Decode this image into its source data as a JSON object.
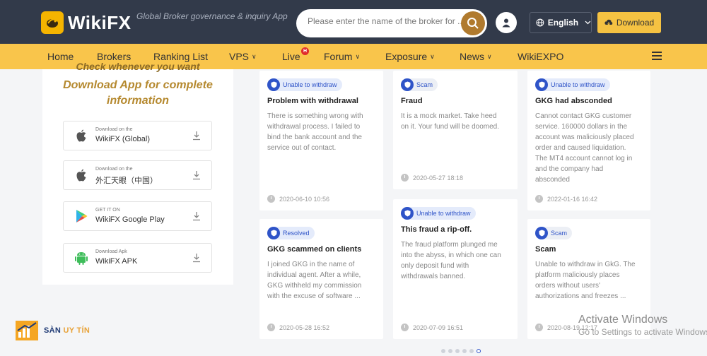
{
  "header": {
    "logo_text": "WikiFX",
    "tagline": "Global Broker governance & inquiry App",
    "search_placeholder": "Please enter the name of the broker for ...",
    "language": "English",
    "download": "Download"
  },
  "nav": {
    "items": [
      "Home",
      "Brokers",
      "Ranking List",
      "VPS",
      "Live",
      "Forum",
      "Exposure",
      "News",
      "WikiEXPO"
    ],
    "live_badge": "H"
  },
  "sidebar": {
    "cut_text": "Check whenever you want",
    "title": "Download App for complete information",
    "stores": [
      {
        "small": "Download on the",
        "name": "WikiFX (Global)"
      },
      {
        "small": "Download on the",
        "name": "外汇天眼（中国）"
      },
      {
        "small": "GET IT ON",
        "name": "WikiFX Google Play"
      },
      {
        "small": "Download Apk",
        "name": "WikiFX APK"
      }
    ]
  },
  "cards": [
    {
      "tag": "Unable to withdraw",
      "title": "Problem with withdrawal",
      "body": "There is something wrong with withdrawal process. I failed to bind the bank account and the service out of contact.",
      "date": "2020-06-10 10:56"
    },
    {
      "tag": "Resolved",
      "title": "GKG scammed on clients",
      "body": "I joined GKG in the name of individual agent. After a while, GKG withheld my commission with the excuse of software ...",
      "date": "2020-05-28 16:52"
    },
    {
      "tag": "Scam",
      "title": "Fraud",
      "body": "It is a mock market. Take heed on it. Your fund will be doomed.",
      "date": "2020-05-27 18:18"
    },
    {
      "tag": "Unable to withdraw",
      "title": "This fraud a rip-off.",
      "body": "The fraud platform plunged me into the abyss, in which one can only deposit fund with withdrawals banned.",
      "date": "2020-07-09 16:51"
    },
    {
      "tag": "Unable to withdraw",
      "title": "GKG had absconded",
      "body": "Cannot contact GKG customer service. 160000 dollars in the account was maliciously placed order and caused liquidation. The MT4 account cannot log in and the company had absconded",
      "date": "2022-01-16 16:42"
    },
    {
      "tag": "Scam",
      "title": "Scam",
      "body": "Unable to withdraw in GkG. The platform maliciously places orders without users' authorizations and freezes ...",
      "date": "2020-08-19 12:17"
    }
  ],
  "watermark": {
    "brand_a": "SÀN ",
    "brand_b": "UY TÍN",
    "activate_title": "Activate Windows",
    "activate_sub": "Go to Settings to activate Windows."
  },
  "colors": {
    "header_bg": "#323a4a",
    "nav_bg": "#f9c54b",
    "accent_gold": "#b5892f",
    "tag_blue": "#2f54c8"
  }
}
